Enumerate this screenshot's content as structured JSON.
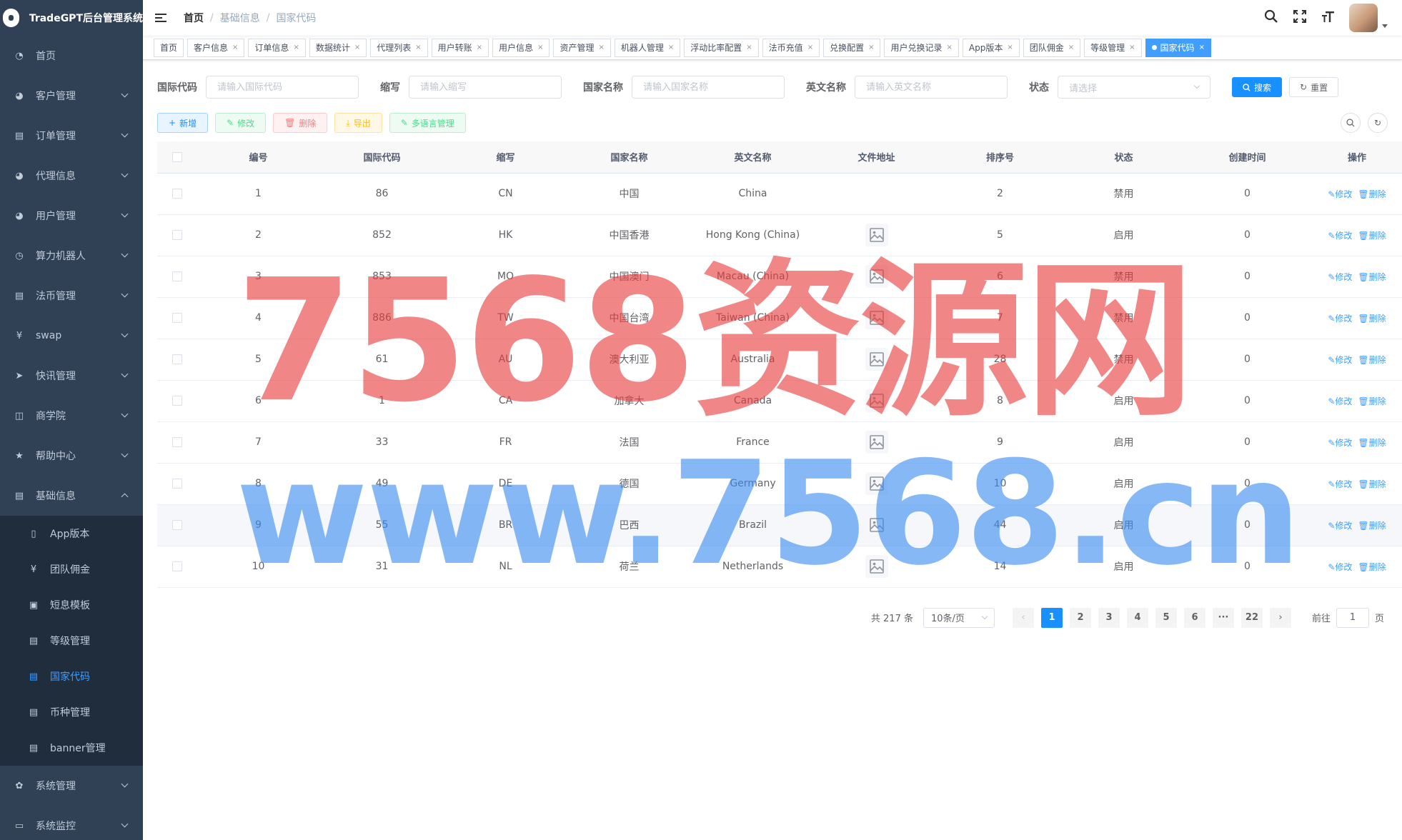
{
  "app": {
    "title": "TradeGPT后台管理系统"
  },
  "sidebar": {
    "items": [
      {
        "label": "首页",
        "icon": "dashboard-icon",
        "glyph": "◔"
      },
      {
        "label": "客户管理",
        "icon": "user-icon",
        "glyph": "◕"
      },
      {
        "label": "订单管理",
        "icon": "document-icon",
        "glyph": "▤"
      },
      {
        "label": "代理信息",
        "icon": "user-icon",
        "glyph": "◕"
      },
      {
        "label": "用户管理",
        "icon": "user-icon",
        "glyph": "◕"
      },
      {
        "label": "算力机器人",
        "icon": "clock-icon",
        "glyph": "◷"
      },
      {
        "label": "法币管理",
        "icon": "document-icon",
        "glyph": "▤"
      },
      {
        "label": "swap",
        "icon": "yen-icon",
        "glyph": "¥"
      },
      {
        "label": "快讯管理",
        "icon": "send-icon",
        "glyph": "➤"
      },
      {
        "label": "商学院",
        "icon": "book-icon",
        "glyph": "◫"
      },
      {
        "label": "帮助中心",
        "icon": "star-icon",
        "glyph": "★"
      },
      {
        "label": "基础信息",
        "icon": "document-icon",
        "glyph": "▤"
      }
    ],
    "submenu": [
      {
        "label": "App版本",
        "icon": "mobile-icon",
        "glyph": "▯"
      },
      {
        "label": "团队佣金",
        "icon": "yen-icon",
        "glyph": "¥"
      },
      {
        "label": "短息模板",
        "icon": "message-icon",
        "glyph": "▣"
      },
      {
        "label": "等级管理",
        "icon": "document-icon",
        "glyph": "▤"
      },
      {
        "label": "国家代码",
        "icon": "document-icon",
        "glyph": "▤"
      },
      {
        "label": "币种管理",
        "icon": "document-icon",
        "glyph": "▤"
      },
      {
        "label": "banner管理",
        "icon": "document-icon",
        "glyph": "▤"
      }
    ],
    "bottom": [
      {
        "label": "系统管理",
        "icon": "gear-icon",
        "glyph": "✿"
      },
      {
        "label": "系统监控",
        "icon": "monitor-icon",
        "glyph": "▭"
      }
    ]
  },
  "breadcrumb": {
    "home": "首页",
    "parent": "基础信息",
    "current": "国家代码"
  },
  "tags": [
    "首页",
    "客户信息",
    "订单信息",
    "数据统计",
    "代理列表",
    "用户转账",
    "用户信息",
    "资产管理",
    "机器人管理",
    "浮动比率配置",
    "法币充值",
    "兑换配置",
    "用户兑换记录",
    "App版本",
    "团队佣金",
    "等级管理"
  ],
  "active_tag": "国家代码",
  "search": {
    "fields": [
      {
        "label": "国际代码",
        "placeholder": "请输入国际代码"
      },
      {
        "label": "缩写",
        "placeholder": "请输入缩写"
      },
      {
        "label": "国家名称",
        "placeholder": "请输入国家名称"
      },
      {
        "label": "英文名称",
        "placeholder": "请输入英文名称"
      }
    ],
    "status_label": "状态",
    "status_placeholder": "请选择",
    "search_btn": "搜索",
    "reset_btn": "重置"
  },
  "toolbar": {
    "add": "新增",
    "edit": "修改",
    "delete": "删除",
    "export": "导出",
    "lang": "多语言管理"
  },
  "table": {
    "columns": [
      "编号",
      "国际代码",
      "缩写",
      "国家名称",
      "英文名称",
      "文件地址",
      "排序号",
      "状态",
      "创建时间",
      "操作"
    ],
    "edit_label": "修改",
    "delete_label": "删除",
    "rows": [
      {
        "id": "1",
        "code": "86",
        "abbr": "CN",
        "name": "中国",
        "en": "China",
        "has_image": false,
        "sort": "2",
        "status": "禁用",
        "created": "0"
      },
      {
        "id": "2",
        "code": "852",
        "abbr": "HK",
        "name": "中国香港",
        "en": "Hong Kong (China)",
        "has_image": true,
        "sort": "5",
        "status": "启用",
        "created": "0"
      },
      {
        "id": "3",
        "code": "853",
        "abbr": "MO",
        "name": "中国澳门",
        "en": "Macau (China)",
        "has_image": true,
        "sort": "6",
        "status": "禁用",
        "created": "0"
      },
      {
        "id": "4",
        "code": "886",
        "abbr": "TW",
        "name": "中国台湾",
        "en": "Taiwan (China)",
        "has_image": true,
        "sort": "7",
        "status": "禁用",
        "created": "0"
      },
      {
        "id": "5",
        "code": "61",
        "abbr": "AU",
        "name": "澳大利亚",
        "en": "Australia",
        "has_image": true,
        "sort": "28",
        "status": "禁用",
        "created": "0"
      },
      {
        "id": "6",
        "code": "1",
        "abbr": "CA",
        "name": "加拿大",
        "en": "Canada",
        "has_image": true,
        "sort": "8",
        "status": "启用",
        "created": "0"
      },
      {
        "id": "7",
        "code": "33",
        "abbr": "FR",
        "name": "法国",
        "en": "France",
        "has_image": true,
        "sort": "9",
        "status": "启用",
        "created": "0"
      },
      {
        "id": "8",
        "code": "49",
        "abbr": "DE",
        "name": "德国",
        "en": "Germany",
        "has_image": true,
        "sort": "10",
        "status": "启用",
        "created": "0"
      },
      {
        "id": "9",
        "code": "55",
        "abbr": "BR",
        "name": "巴西",
        "en": "Brazil",
        "has_image": true,
        "sort": "44",
        "status": "启用",
        "created": "0"
      },
      {
        "id": "10",
        "code": "31",
        "abbr": "NL",
        "name": "荷兰",
        "en": "Netherlands",
        "has_image": true,
        "sort": "14",
        "status": "启用",
        "created": "0"
      }
    ]
  },
  "pagination": {
    "total_label": "共 217 条",
    "page_size": "10条/页",
    "pages": [
      "1",
      "2",
      "3",
      "4",
      "5",
      "6",
      "···",
      "22"
    ],
    "current": "1",
    "goto_label": "前往",
    "goto_value": "1",
    "page_suffix": "页"
  },
  "watermark": {
    "line1": "7568资源网",
    "line2": "www.7568.cn"
  }
}
